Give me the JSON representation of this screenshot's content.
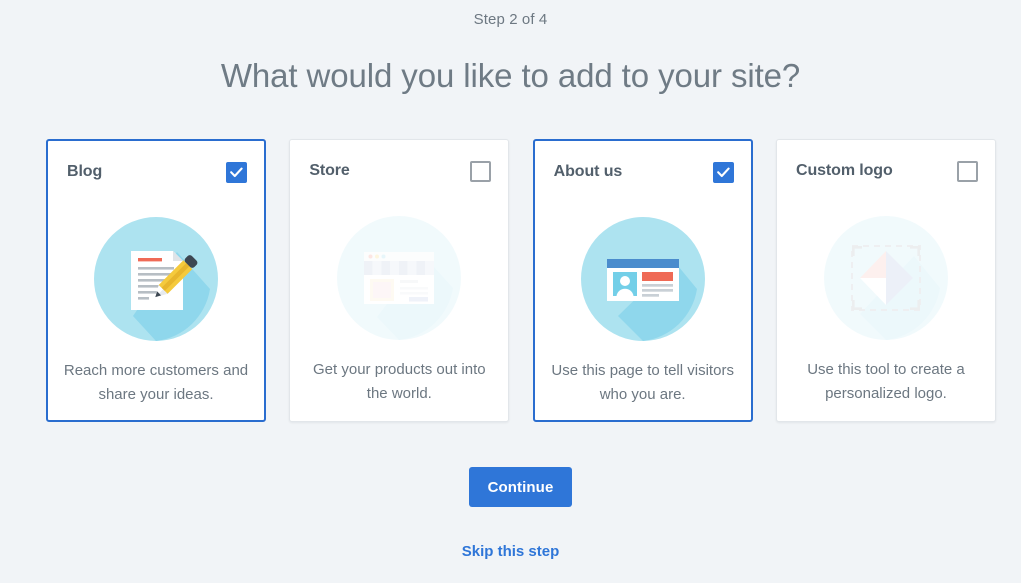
{
  "header": {
    "step_label": "Step 2 of 4",
    "headline": "What would you like to add to your site?"
  },
  "colors": {
    "page_background": "#f1f4f7",
    "card_background": "#ffffff",
    "accent_blue": "#2f76d8",
    "selected_border": "#2a6dcf",
    "title_text": "#525f6b",
    "body_text": "#6c7781",
    "checkbox_unchecked_border": "#9aa1a8",
    "illustration_circle": "#ade3f0",
    "illustration_red": "#ef6a56",
    "illustration_yellow": "#f5ca3c"
  },
  "cards": [
    {
      "id": "blog",
      "title": "Blog",
      "description": "Reach more customers and share your ideas.",
      "selected": true,
      "checkbox_state": "checked",
      "illustration": "blog-document-pencil-icon"
    },
    {
      "id": "store",
      "title": "Store",
      "description": "Get your products out into the world.",
      "selected": false,
      "checkbox_state": "unchecked",
      "illustration": "store-storefront-icon"
    },
    {
      "id": "about-us",
      "title": "About us",
      "description": "Use this page to tell visitors who you are.",
      "selected": true,
      "checkbox_state": "checked",
      "illustration": "about-us-profile-card-icon"
    },
    {
      "id": "custom-logo",
      "title": "Custom logo",
      "description": "Use this tool to create a personalized logo.",
      "selected": false,
      "checkbox_state": "unchecked",
      "illustration": "custom-logo-diamond-icon"
    }
  ],
  "actions": {
    "continue_label": "Continue",
    "skip_label": "Skip this step"
  }
}
